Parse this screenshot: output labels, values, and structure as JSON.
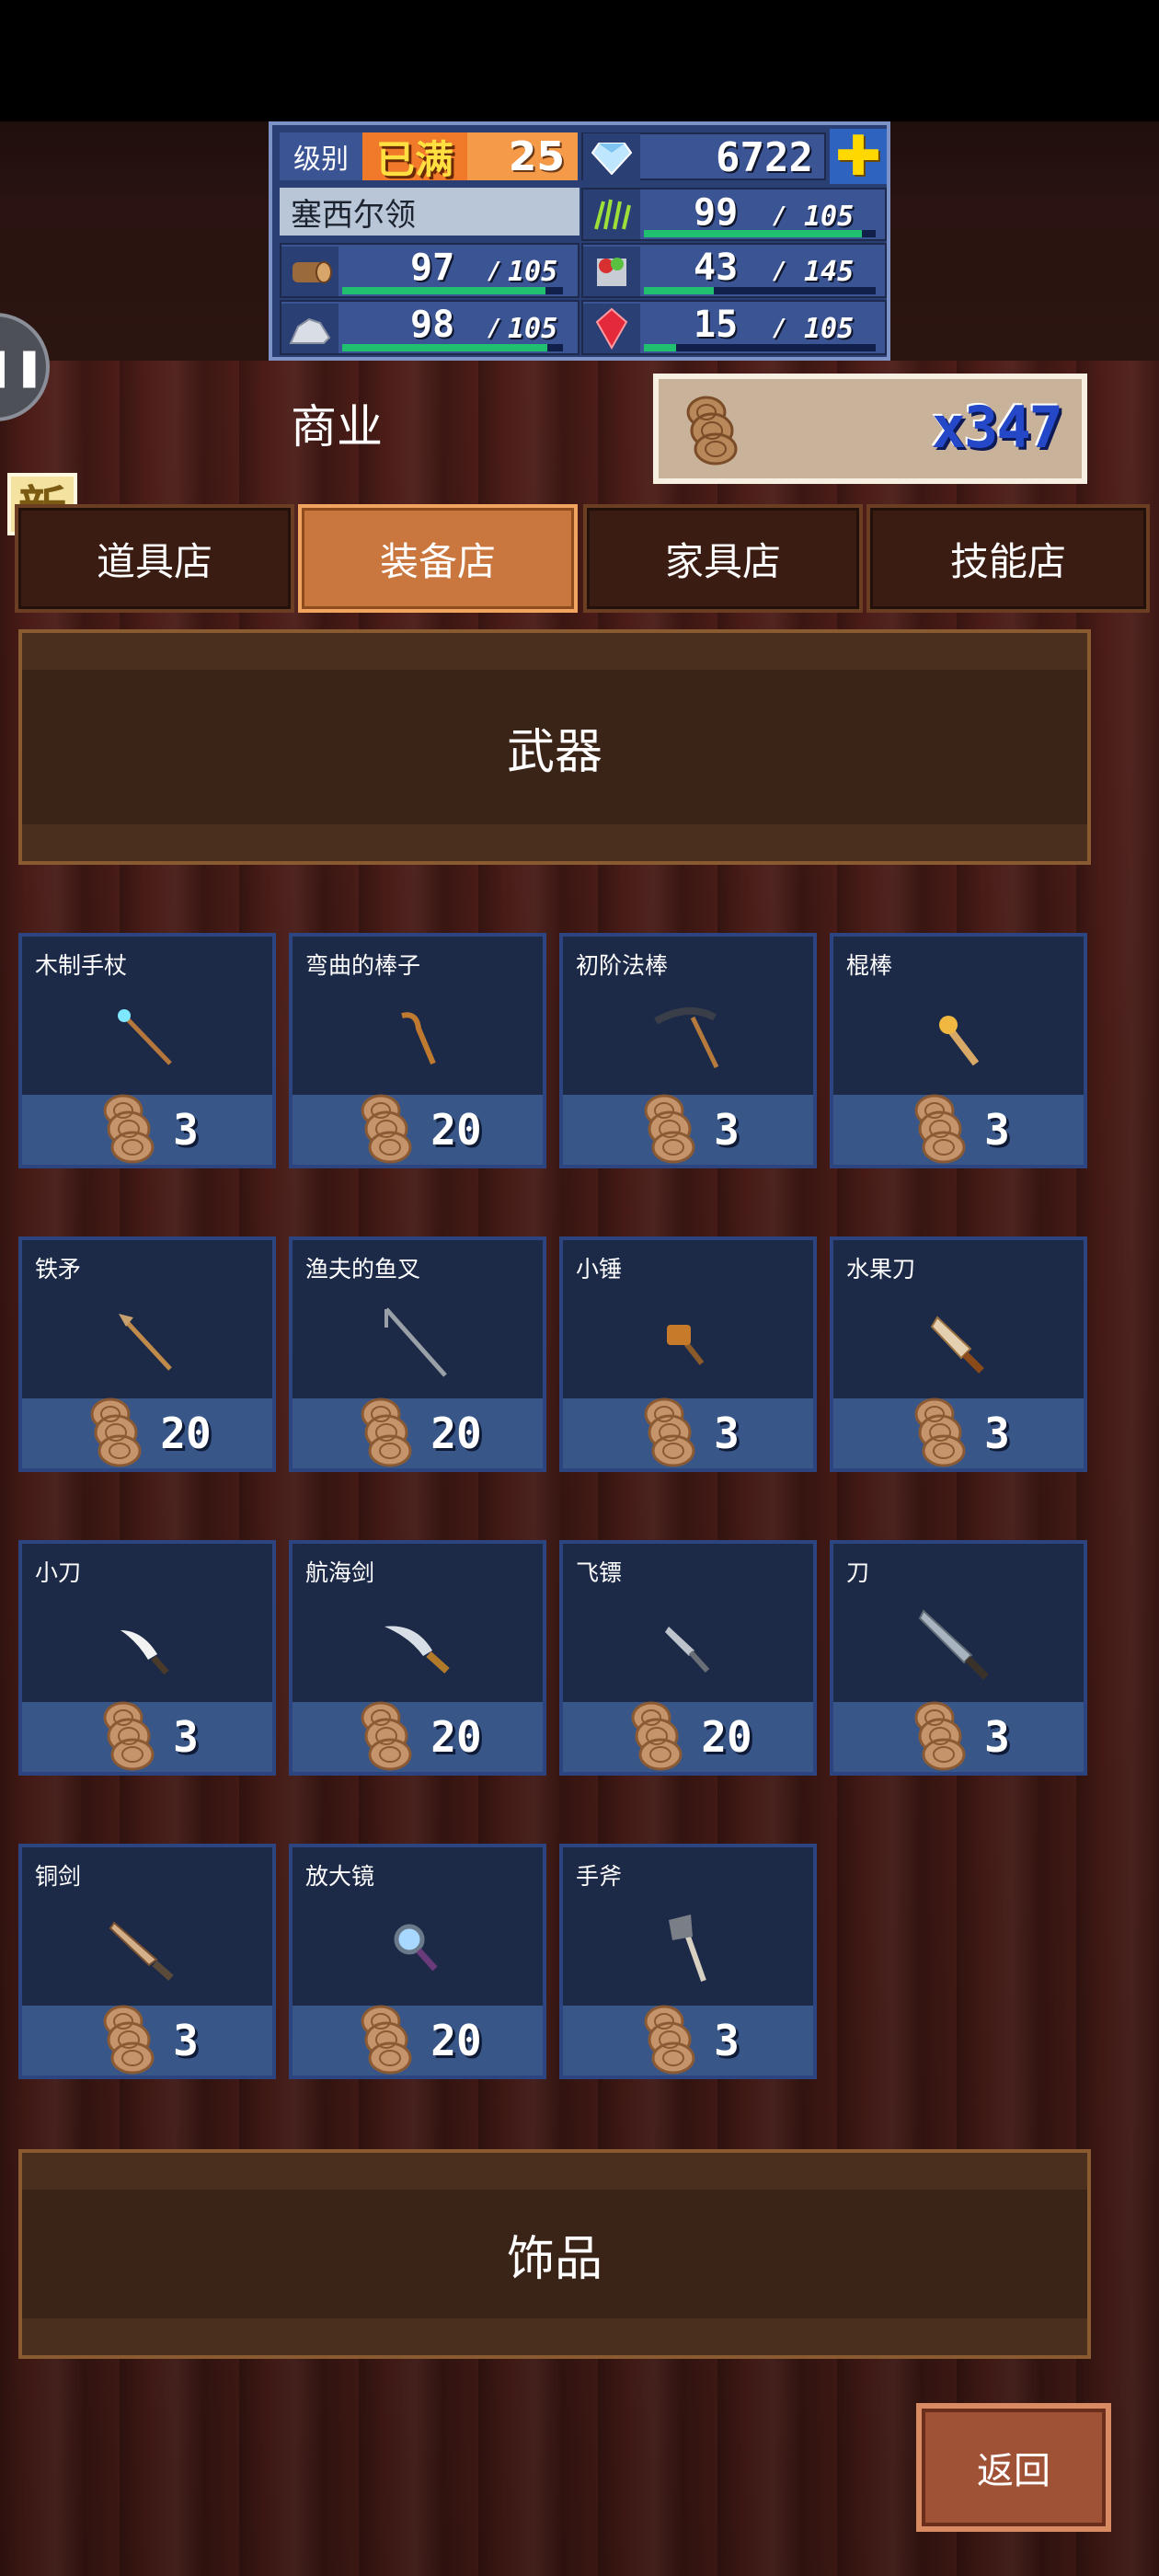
{
  "hud": {
    "level_label": "级别",
    "level_status": "已满",
    "level": "25",
    "gems": "6722",
    "region": "塞西尔领",
    "resources": [
      {
        "icon": "grass-icon",
        "value": "99",
        "max": "105",
        "fill": 0.94
      },
      {
        "icon": "wood-icon",
        "value": "97",
        "max": "105",
        "fill": 0.92
      },
      {
        "icon": "food-icon",
        "value": "43",
        "max": "145",
        "fill": 0.3
      },
      {
        "icon": "ore-icon",
        "value": "98",
        "max": "105",
        "fill": 0.93
      },
      {
        "icon": "ruby-icon",
        "value": "15",
        "max": "105",
        "fill": 0.14
      }
    ]
  },
  "header": {
    "title": "商业",
    "currency_count": "x347",
    "new_badge": "新"
  },
  "tabs": [
    {
      "label": "道具店",
      "active": false
    },
    {
      "label": "装备店",
      "active": true
    },
    {
      "label": "家具店",
      "active": false
    },
    {
      "label": "技能店",
      "active": false
    }
  ],
  "sections": {
    "weapons": "武器",
    "accessories": "饰品"
  },
  "items": [
    {
      "name": "木制手杖",
      "price": "3",
      "icon": "staff-icon"
    },
    {
      "name": "弯曲的棒子",
      "price": "20",
      "icon": "crooked-stick-icon"
    },
    {
      "name": "初阶法棒",
      "price": "3",
      "icon": "scythe-icon"
    },
    {
      "name": "棍棒",
      "price": "3",
      "icon": "club-icon"
    },
    {
      "name": "铁矛",
      "price": "20",
      "icon": "spear-icon"
    },
    {
      "name": "渔夫的鱼叉",
      "price": "20",
      "icon": "harpoon-icon"
    },
    {
      "name": "小锤",
      "price": "3",
      "icon": "hammer-icon"
    },
    {
      "name": "水果刀",
      "price": "3",
      "icon": "fruit-knife-icon"
    },
    {
      "name": "小刀",
      "price": "3",
      "icon": "small-knife-icon"
    },
    {
      "name": "航海剑",
      "price": "20",
      "icon": "cutlass-icon"
    },
    {
      "name": "飞镖",
      "price": "20",
      "icon": "dart-icon"
    },
    {
      "name": "刀",
      "price": "3",
      "icon": "blade-icon"
    },
    {
      "name": "铜剑",
      "price": "3",
      "icon": "bronze-sword-icon"
    },
    {
      "name": "放大镜",
      "price": "20",
      "icon": "magnifier-icon"
    },
    {
      "name": "手斧",
      "price": "3",
      "icon": "hatchet-icon"
    }
  ],
  "back_label": "返回"
}
